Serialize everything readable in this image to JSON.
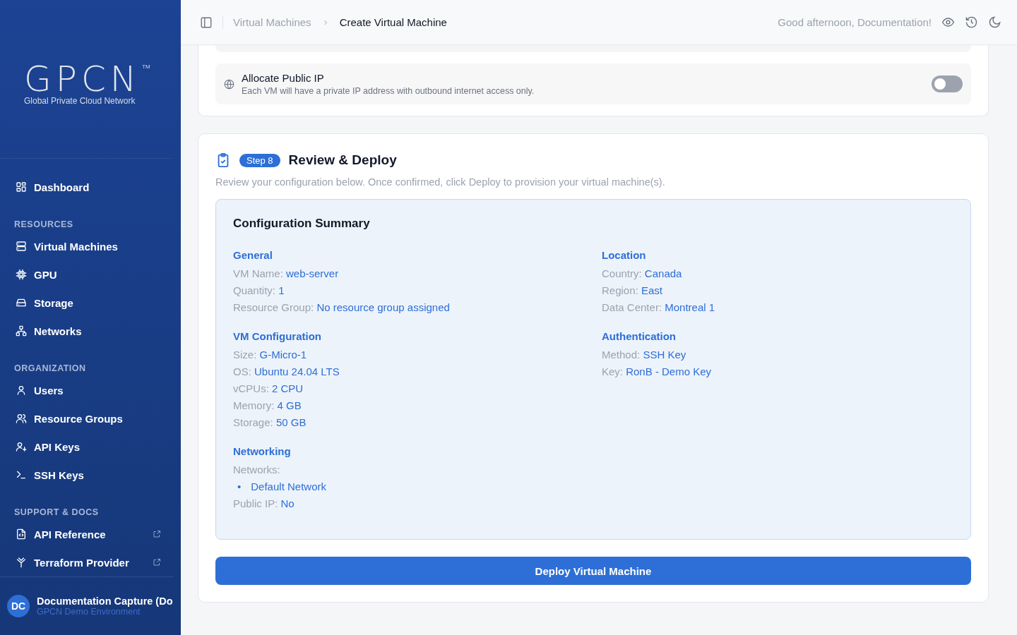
{
  "brand": {
    "logo": "GPCN",
    "trademark": "TM",
    "tagline": "Global Private Cloud Network"
  },
  "sidebar": {
    "top": [
      {
        "label": "Dashboard",
        "selected": false
      }
    ],
    "groups": [
      {
        "heading": "RESOURCES",
        "items": [
          {
            "label": "Virtual Machines",
            "selected": false,
            "external": false
          },
          {
            "label": "GPU",
            "selected": false,
            "external": false
          },
          {
            "label": "Storage",
            "selected": false,
            "external": false
          },
          {
            "label": "Networks",
            "selected": false,
            "external": false
          }
        ]
      },
      {
        "heading": "ORGANIZATION",
        "items": [
          {
            "label": "Users",
            "selected": false,
            "external": false
          },
          {
            "label": "Resource Groups",
            "selected": false,
            "external": false
          },
          {
            "label": "API Keys",
            "selected": false,
            "external": false
          },
          {
            "label": "SSH Keys",
            "selected": false,
            "external": false
          }
        ]
      },
      {
        "heading": "SUPPORT & DOCS",
        "items": [
          {
            "label": "API Reference",
            "selected": false,
            "external": true
          },
          {
            "label": "Terraform Provider",
            "selected": false,
            "external": true
          }
        ]
      }
    ],
    "user": {
      "initials": "DC",
      "name": "Documentation Capture (Do",
      "org": "GPCN Demo Environment"
    }
  },
  "header": {
    "breadcrumbs": [
      "Virtual Machines",
      "Create Virtual Machine"
    ],
    "greeting": "Good afternoon, Documentation!"
  },
  "public_ip": {
    "title": "Allocate Public IP",
    "description": "Each VM will have a private IP address with outbound internet access only.",
    "on": false
  },
  "review": {
    "step": "Step 8",
    "title": "Review & Deploy",
    "description": "Review your configuration below. Once confirmed, click Deploy to provision your virtual machine(s).",
    "summary": {
      "title": "Configuration Summary",
      "columns": [
        [
          {
            "heading": "General",
            "rows": [
              {
                "label": "VM Name:",
                "value": "web-server"
              },
              {
                "label": "Quantity:",
                "value": "1"
              },
              {
                "label": "Resource Group:",
                "value": "No resource group assigned"
              }
            ]
          },
          {
            "heading": "VM Configuration",
            "rows": [
              {
                "label": "Size:",
                "value": "G-Micro-1"
              },
              {
                "label": "OS:",
                "value": "Ubuntu 24.04 LTS"
              },
              {
                "label": "vCPUs:",
                "value": "2 CPU"
              },
              {
                "label": "Memory:",
                "value": "4 GB"
              },
              {
                "label": "Storage:",
                "value": "50 GB"
              }
            ]
          },
          {
            "heading": "Networking",
            "rows": [
              {
                "label": "Networks:",
                "list": [
                  {
                    "marker": "•",
                    "text": "Default Network"
                  }
                ]
              },
              {
                "label": "Public IP:",
                "value": "No"
              }
            ]
          }
        ],
        [
          {
            "heading": "Location",
            "rows": [
              {
                "label": "Country:",
                "value": "Canada"
              },
              {
                "label": "Region:",
                "value": "East"
              },
              {
                "label": "Data Center:",
                "value": "Montreal 1"
              }
            ]
          },
          {
            "heading": "Authentication",
            "rows": [
              {
                "label": "Method:",
                "value": "SSH Key"
              },
              {
                "label": "Key:",
                "value": "RonB - Demo Key"
              }
            ]
          }
        ]
      ]
    },
    "button": "Deploy Virtual Machine"
  }
}
